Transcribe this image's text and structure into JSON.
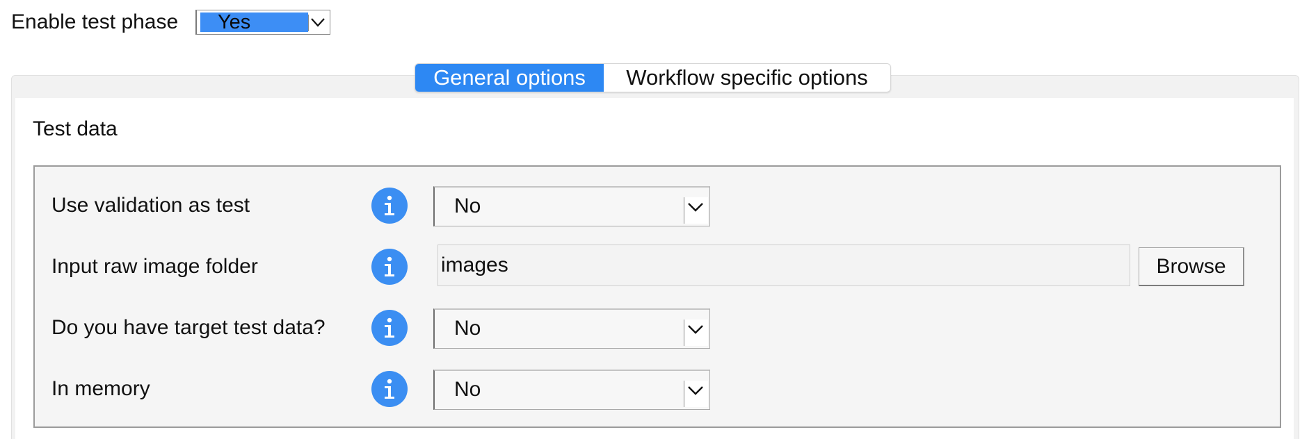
{
  "top": {
    "label": "Enable test phase",
    "select_value": "Yes"
  },
  "tabs": [
    {
      "label": "General options",
      "active": true
    },
    {
      "label": "Workflow specific options",
      "active": false
    }
  ],
  "section": {
    "title": "Test data"
  },
  "rows": [
    {
      "label": "Use validation as test",
      "type": "select",
      "value": "No"
    },
    {
      "label": "Input raw image folder",
      "type": "text",
      "value": "images",
      "button_label": "Browse"
    },
    {
      "label": "Do you have target test data?",
      "type": "select",
      "value": "No"
    },
    {
      "label": "In memory",
      "type": "select",
      "value": "No"
    }
  ],
  "colors": {
    "accent": "#2d88f3",
    "info_icon": "#3b8ef2",
    "selected_highlight": "#3d8ef5"
  },
  "icons": {
    "info": "info-icon",
    "dropdown": "chevron-down-icon"
  }
}
